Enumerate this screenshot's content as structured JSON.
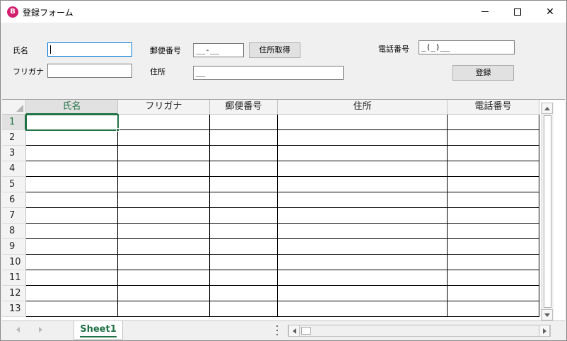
{
  "window": {
    "title": "登録フォーム",
    "icon": "excel-app-icon",
    "icon_glyph": "B",
    "controls": {
      "minimize": "minimize-icon",
      "maximize": "maximize-icon",
      "close": "close-icon",
      "close_glyph": "✕"
    }
  },
  "form": {
    "name_label": "氏名",
    "name_value": "",
    "furigana_label": "フリガナ",
    "furigana_value": "",
    "postal_label": "郵便番号",
    "postal_value": "__-__",
    "postal_button": "住所取得",
    "address_label": "住所",
    "address_value": "__",
    "phone_label": "電話番号",
    "phone_value": "_(_)__",
    "register_button": "登録"
  },
  "sheet": {
    "columns": [
      "氏名",
      "フリガナ",
      "郵便番号",
      "住所",
      "電話番号"
    ],
    "rows": [
      "1",
      "2",
      "3",
      "4",
      "5",
      "6",
      "7",
      "8",
      "9",
      "10",
      "11",
      "12",
      "13"
    ],
    "active_cell": "1-氏名",
    "tab_name": "Sheet1"
  },
  "colors": {
    "accent": "#217346",
    "focus_border": "#0078d7",
    "app_icon": "#d1206f"
  }
}
